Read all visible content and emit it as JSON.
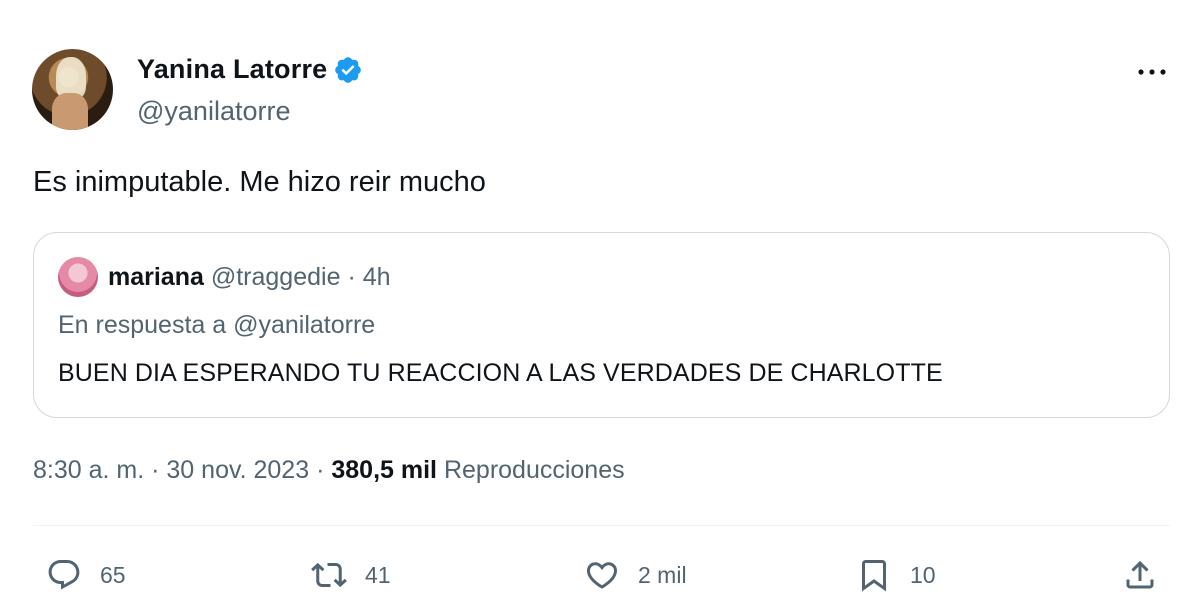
{
  "author": {
    "name": "Yanina Latorre",
    "handle": "@yanilatorre",
    "verified_icon": "verified-badge-icon",
    "verified_color": "#1d9bf0"
  },
  "tweet": {
    "text": "Es inimputable. Me hizo reir mucho"
  },
  "quoted_tweet": {
    "name": "mariana",
    "handle": "@traggedie",
    "separator": "·",
    "time": "4h",
    "reply_to": "En respuesta a @yanilatorre",
    "text": "BUEN DIA ESPERANDO TU REACCION A LAS VERDADES DE CHARLOTTE"
  },
  "meta": {
    "time": "8:30 a. m.",
    "sep1": "·",
    "date": "30 nov. 2023",
    "sep2": "·",
    "views_count": "380,5 mil",
    "views_label": "Reproducciones"
  },
  "actions": {
    "reply": {
      "icon": "reply-icon",
      "count": "65"
    },
    "retweet": {
      "icon": "retweet-icon",
      "count": "41"
    },
    "like": {
      "icon": "heart-icon",
      "count": "2 mil"
    },
    "bookmark": {
      "icon": "bookmark-icon",
      "count": "10"
    },
    "share": {
      "icon": "share-icon"
    }
  },
  "colors": {
    "text_primary": "#0f1419",
    "text_secondary": "#536471",
    "border": "#cfd9de"
  }
}
